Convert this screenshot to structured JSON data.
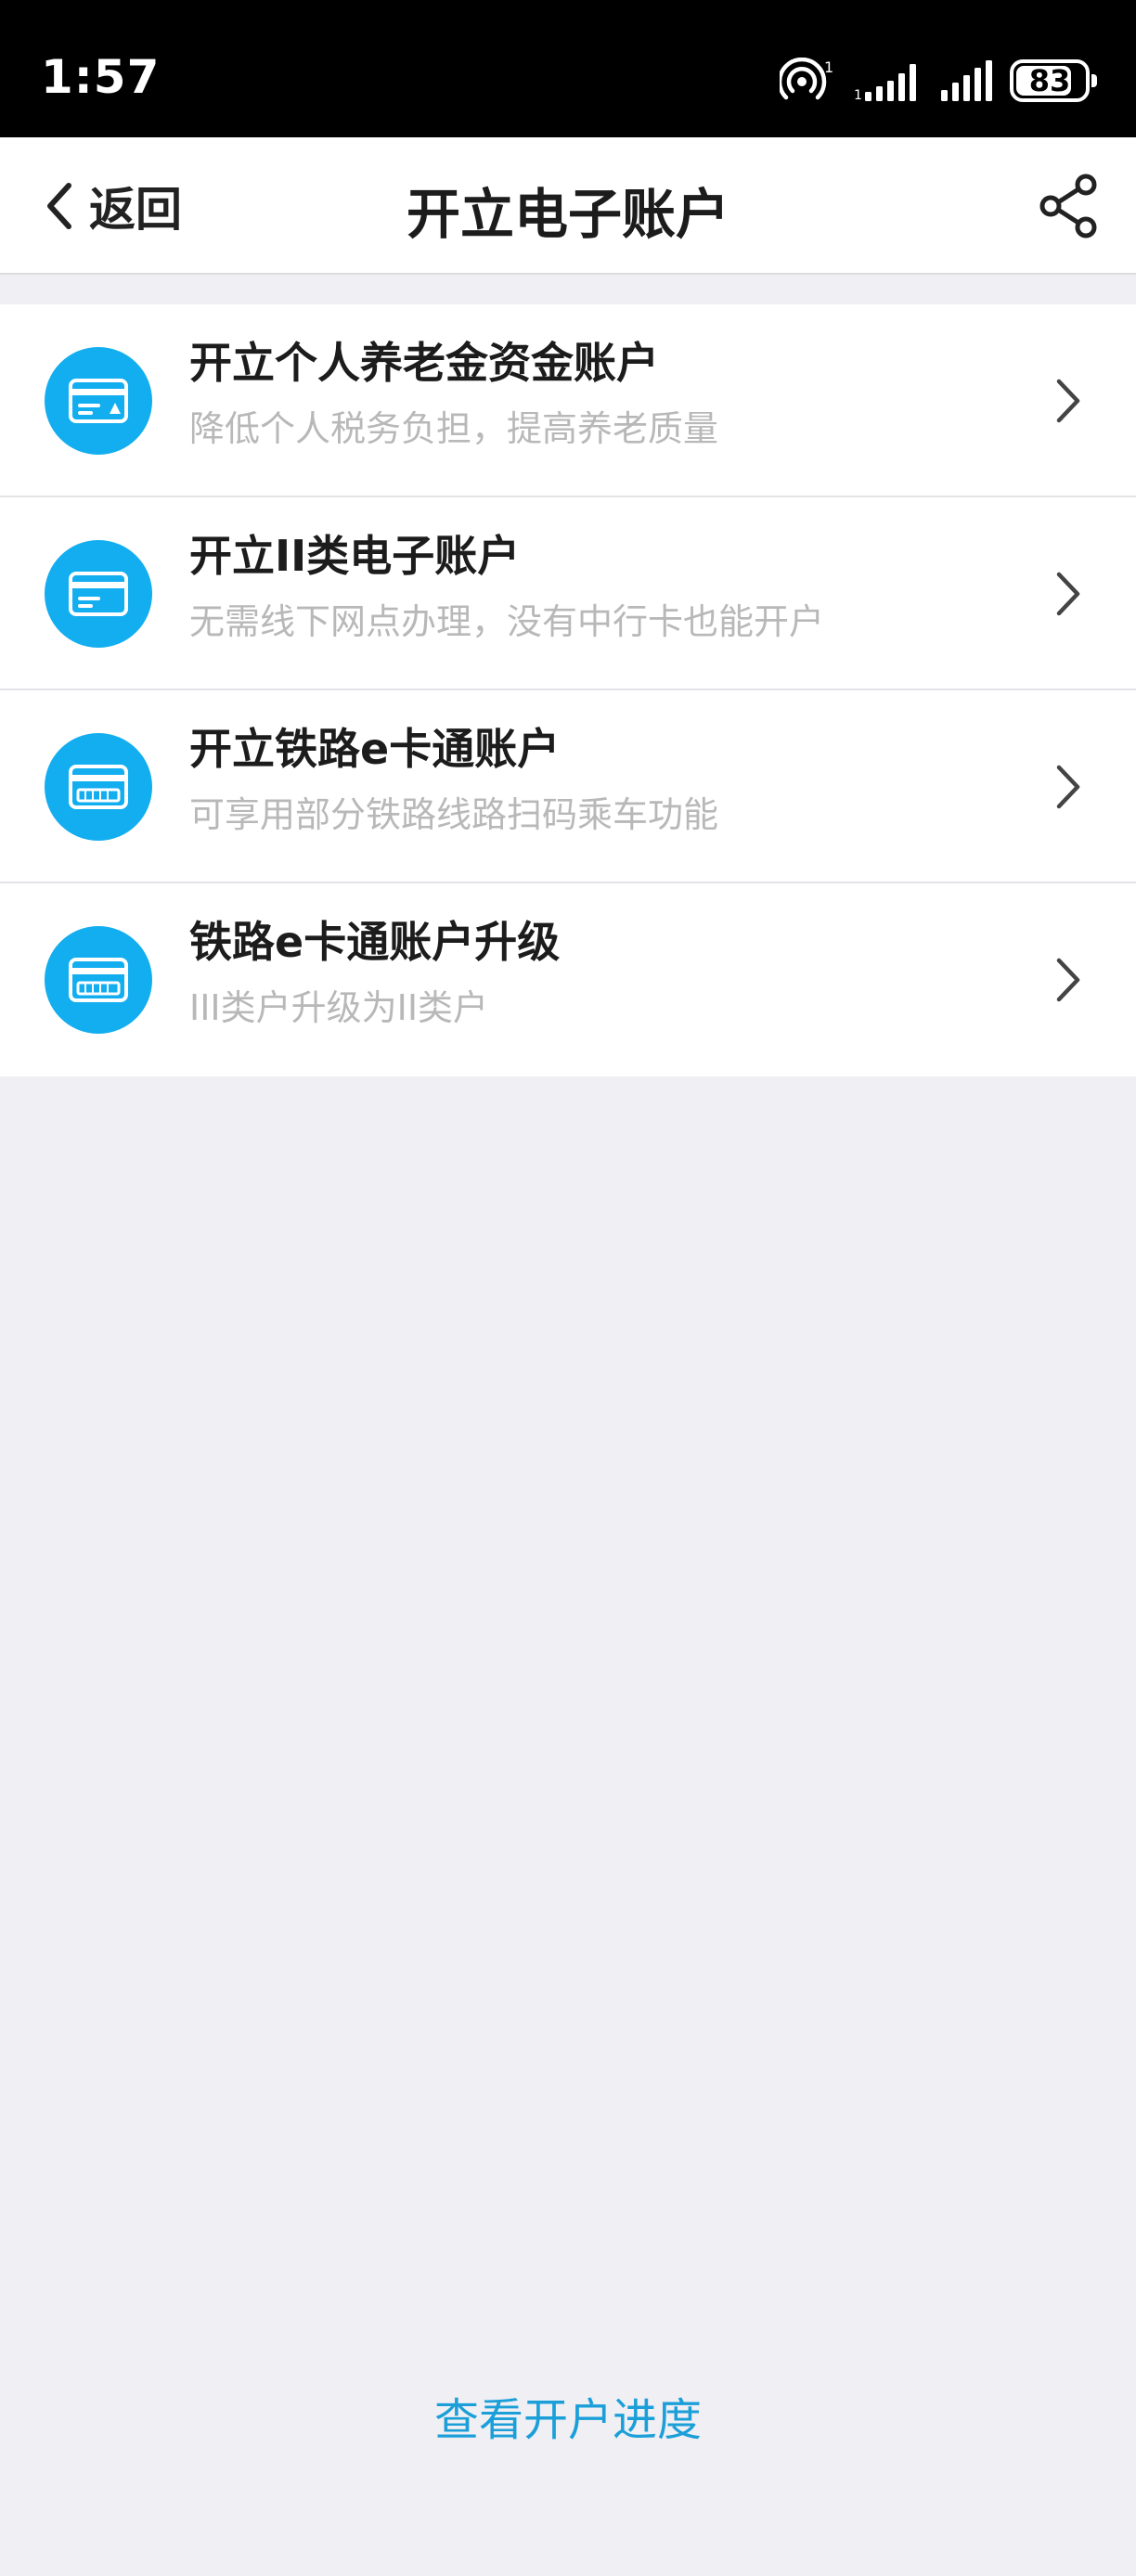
{
  "status_bar": {
    "time": "1:57",
    "hotspot_count": "1",
    "battery_level": "83",
    "battery_fraction": 0.83
  },
  "nav": {
    "back_label": "返回",
    "title": "开立电子账户",
    "share_icon": "share-icon"
  },
  "list": {
    "items": [
      {
        "title": "开立个人养老金资金账户",
        "subtitle": "降低个人税务负担，提高养老质量",
        "icon": "pension-card-icon"
      },
      {
        "title": "开立II类电子账户",
        "subtitle": "无需线下网点办理，没有中行卡也能开户",
        "icon": "card-icon"
      },
      {
        "title": "开立铁路e卡通账户",
        "subtitle": "可享用部分铁路线路扫码乘车功能",
        "icon": "rail-card-icon"
      },
      {
        "title": "铁路e卡通账户升级",
        "subtitle": "III类户升级为II类户",
        "icon": "rail-card-icon"
      }
    ]
  },
  "footer": {
    "progress_link": "查看开户进度"
  },
  "colors": {
    "accent": "#13aef0",
    "link": "#1b9fd9",
    "background": "#efeff4",
    "subtitle": "#b8b8b8"
  }
}
